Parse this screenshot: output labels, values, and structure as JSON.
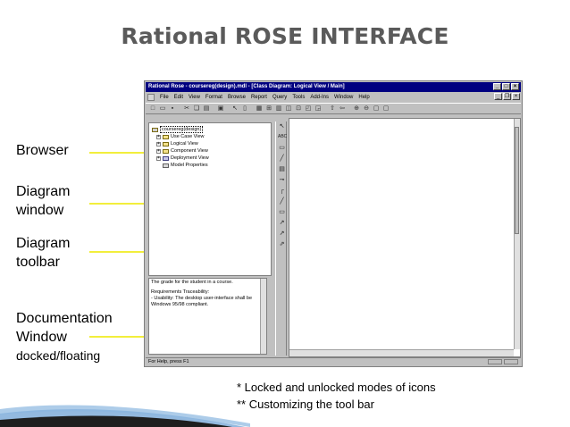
{
  "slide": {
    "title": "Rational ROSE INTERFACE",
    "labels": {
      "browser": "Browser",
      "diagram_window_1": "Diagram",
      "diagram_window_2": "window",
      "diagram_toolbar_1": "Diagram",
      "diagram_toolbar_2": "toolbar",
      "documentation_1": "Documentation",
      "documentation_2": "Window",
      "documentation_3": "docked/floating"
    },
    "notes": [
      "* Locked and unlocked modes of icons",
      "** Customizing the tool bar"
    ],
    "colors": {
      "pointer": "#f2ee3c",
      "titlebar": "#000080",
      "title_text": "#5a5a5a"
    }
  },
  "window": {
    "title": "Rational Rose - coursereg(design).mdl - [Class Diagram: Logical View / Main]",
    "menus": [
      "File",
      "Edit",
      "View",
      "Format",
      "Browse",
      "Report",
      "Query",
      "Tools",
      "Add-Ins",
      "Window",
      "Help"
    ],
    "status_text": "For Help, press F1"
  },
  "browser": {
    "root": "coursereg(design)",
    "items": [
      "Use Case View",
      "Logical View",
      "Component View",
      "Deployment View",
      "Model Properties"
    ]
  },
  "documentation": {
    "lines": [
      "The grade for the student in a course.",
      "",
      "Requirements Traceability:",
      "- Usability: The desktop user-interface shall be",
      "Windows 95/98 compliant."
    ]
  },
  "diagram_toolbar": {
    "text_tool": "ABC"
  }
}
